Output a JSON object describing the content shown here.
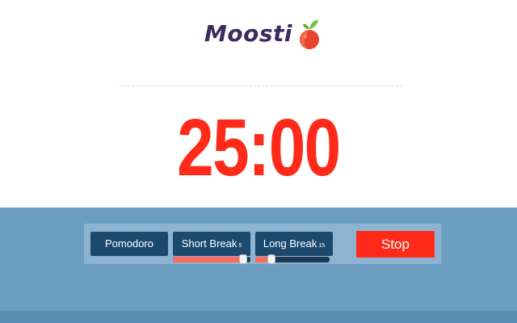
{
  "app": {
    "name": "Moosti",
    "logo_icon": "tomato-icon"
  },
  "timer": {
    "display": "25:00"
  },
  "modes": {
    "pomodoro_label": "Pomodoro",
    "short_break_label": "Short Break",
    "short_break_value": "5",
    "long_break_label": "Long Break",
    "long_break_value": "15"
  },
  "sliders": {
    "short_break_level": 0.92,
    "long_break_level": 0.23
  },
  "actions": {
    "stop_label": "Stop"
  },
  "colors": {
    "accent": "#ff2a1a",
    "brand_text": "#3b2a5e",
    "button_bg": "#1b4a6e",
    "panel_bg": "#8db3d1",
    "footer_bg": "#6c9ec1",
    "slider_fill": "#ff6a5a"
  }
}
